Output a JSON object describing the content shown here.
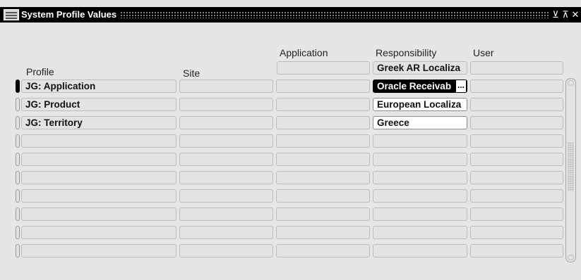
{
  "window": {
    "title": "System Profile Values",
    "controls": {
      "minimize": "⊻",
      "maximize": "⊼",
      "close": "✕"
    }
  },
  "columns": {
    "profile": "Profile",
    "site": "Site",
    "application": "Application",
    "responsibility": "Responsibility",
    "user": "User"
  },
  "filter": {
    "application": "",
    "responsibility": "Greek AR Localiza",
    "user": ""
  },
  "rows": [
    {
      "profile": "JG: Application",
      "site": "",
      "application": "",
      "responsibility": "Oracle Receivab",
      "user": ""
    },
    {
      "profile": "JG: Product",
      "site": "",
      "application": "",
      "responsibility": "European Localiza",
      "user": ""
    },
    {
      "profile": "JG: Territory",
      "site": "",
      "application": "",
      "responsibility": "Greece",
      "user": ""
    },
    {
      "profile": "",
      "site": "",
      "application": "",
      "responsibility": "",
      "user": ""
    },
    {
      "profile": "",
      "site": "",
      "application": "",
      "responsibility": "",
      "user": ""
    },
    {
      "profile": "",
      "site": "",
      "application": "",
      "responsibility": "",
      "user": ""
    },
    {
      "profile": "",
      "site": "",
      "application": "",
      "responsibility": "",
      "user": ""
    },
    {
      "profile": "",
      "site": "",
      "application": "",
      "responsibility": "",
      "user": ""
    },
    {
      "profile": "",
      "site": "",
      "application": "",
      "responsibility": "",
      "user": ""
    },
    {
      "profile": "",
      "site": "",
      "application": "",
      "responsibility": "",
      "user": ""
    }
  ],
  "selected": {
    "ellipsis": "..."
  },
  "colors": {
    "titlebar": "#000000",
    "field": "#e3e3e3",
    "active_field": "#ffffff",
    "selected": "#000000"
  },
  "icons": {
    "app": "oracle-app-icon",
    "scroll": "vertical-scrollbar"
  }
}
